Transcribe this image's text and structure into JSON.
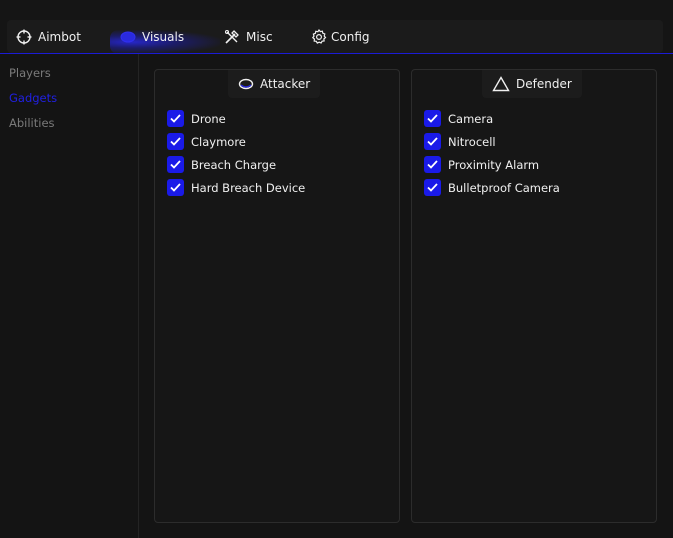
{
  "tabs": [
    {
      "label": "Aimbot",
      "icon": "crosshair-icon"
    },
    {
      "label": "Visuals",
      "icon": "eye-icon",
      "active": true
    },
    {
      "label": "Misc",
      "icon": "tools-icon"
    },
    {
      "label": "Config",
      "icon": "gear-icon"
    }
  ],
  "sidebar": {
    "items": [
      {
        "label": "Players"
      },
      {
        "label": "Gadgets",
        "active": true
      },
      {
        "label": "Abilities"
      }
    ]
  },
  "panels": {
    "attacker": {
      "title": "Attacker",
      "icon": "ellipse-icon",
      "items": [
        {
          "label": "Drone",
          "checked": true
        },
        {
          "label": "Claymore",
          "checked": true
        },
        {
          "label": "Breach Charge",
          "checked": true
        },
        {
          "label": "Hard Breach Device",
          "checked": true
        }
      ]
    },
    "defender": {
      "title": "Defender",
      "icon": "triangle-icon",
      "items": [
        {
          "label": "Camera",
          "checked": true
        },
        {
          "label": "Nitrocell",
          "checked": true
        },
        {
          "label": "Proximity Alarm",
          "checked": true
        },
        {
          "label": "Bulletproof Camera",
          "checked": true
        }
      ]
    }
  },
  "colors": {
    "accent": "#1a1ae8",
    "background": "#141414",
    "muted_text": "#7a7a7a"
  }
}
